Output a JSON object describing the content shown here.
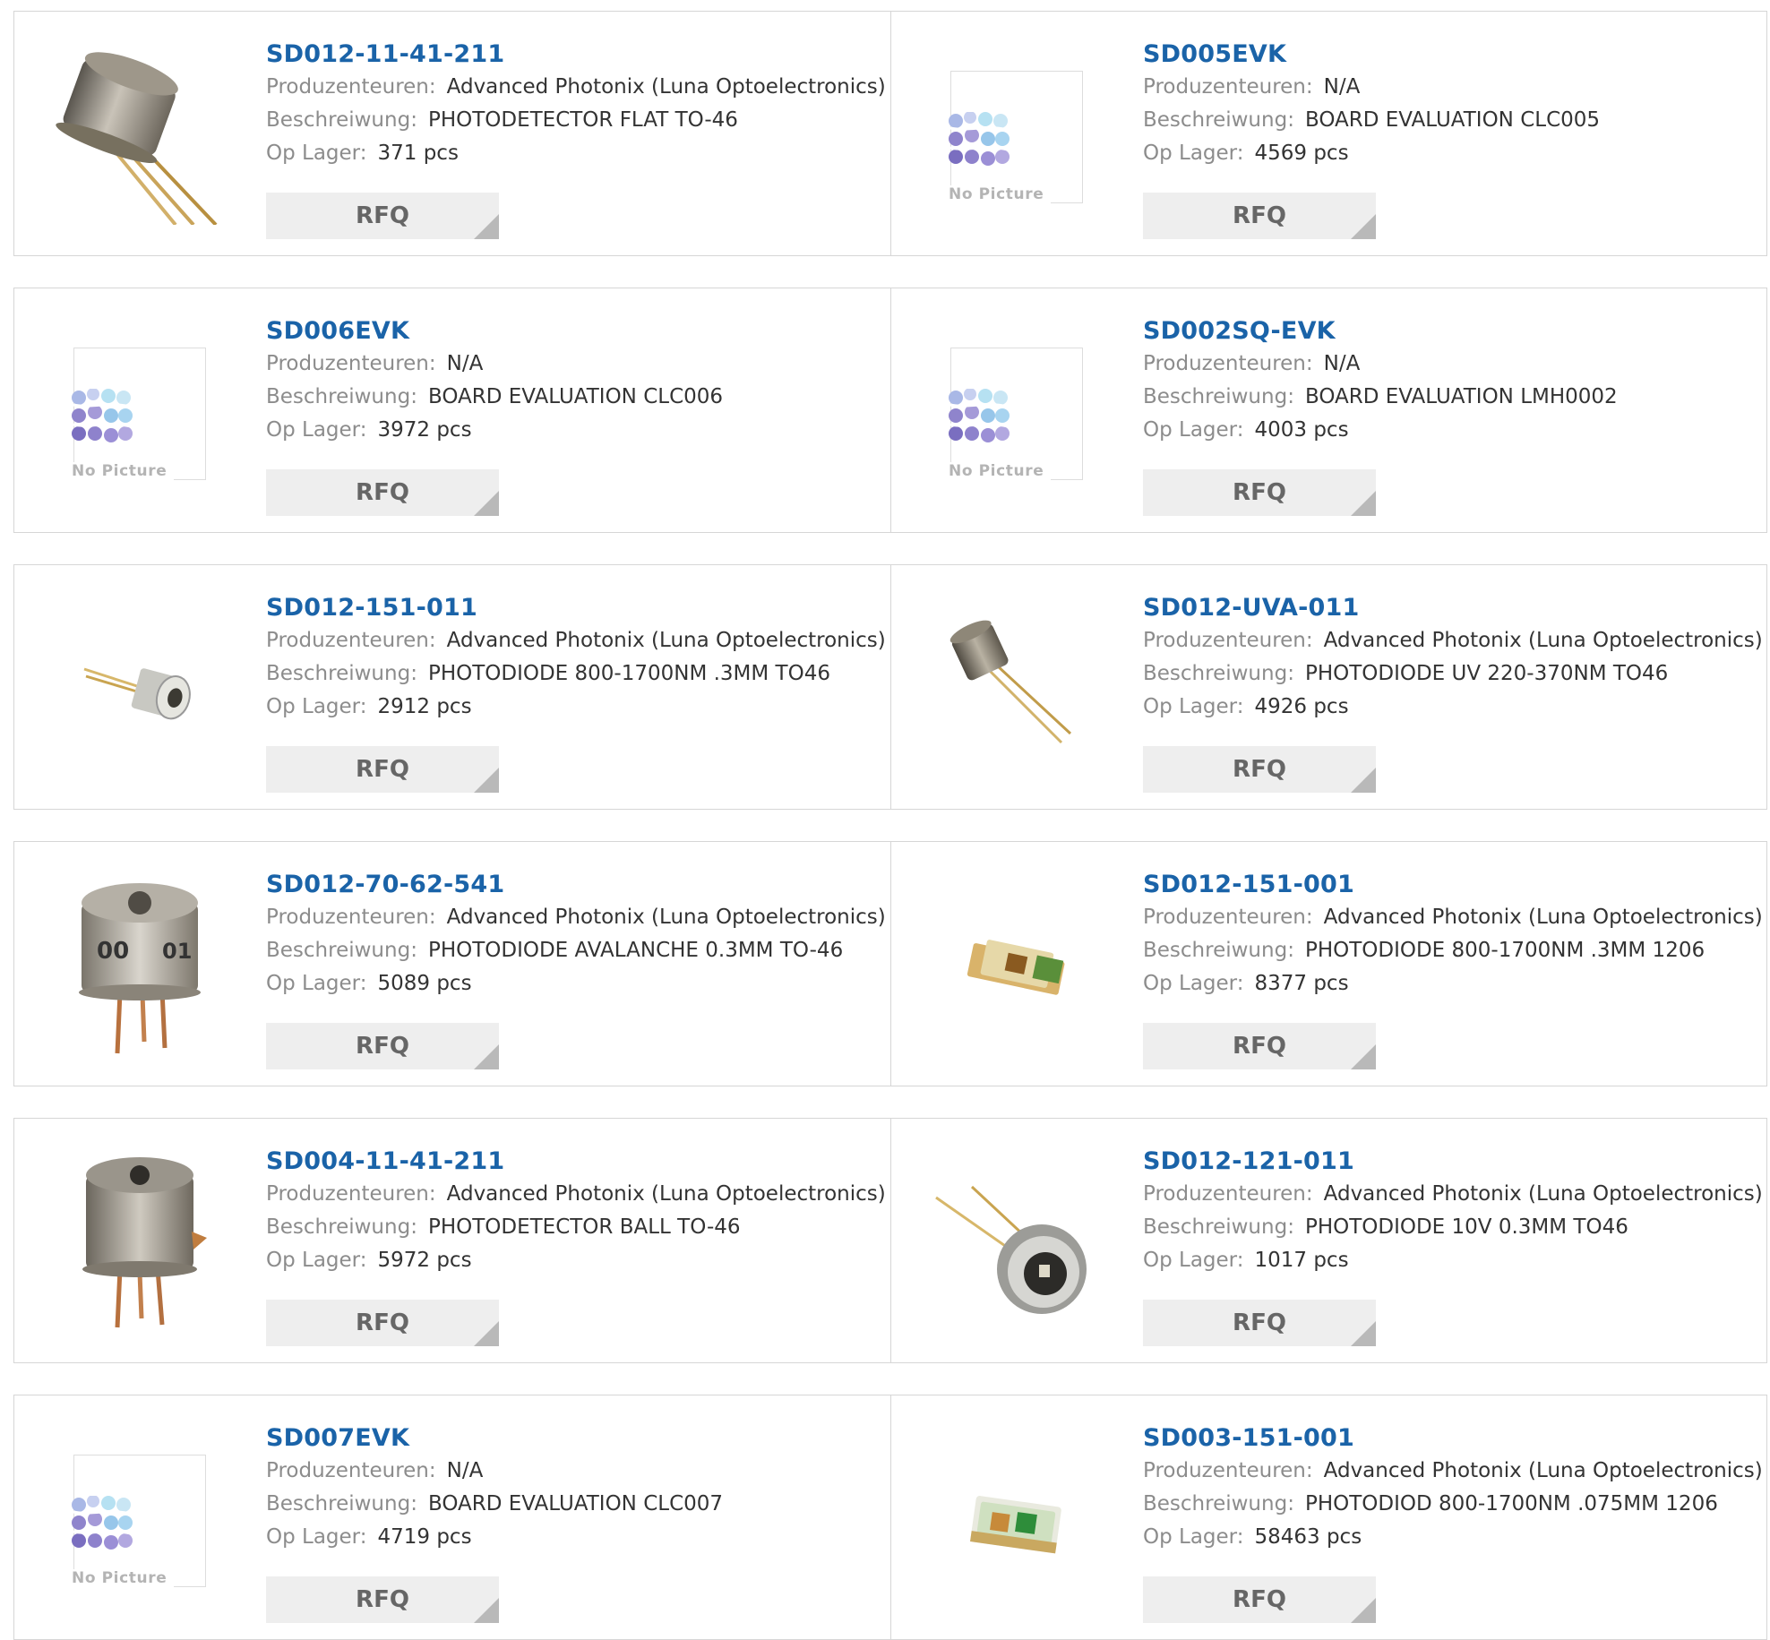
{
  "labels": {
    "manufacturer": "Produzenteuren:",
    "description": "Beschreiwung:",
    "stock": "Op Lager:",
    "rfq": "RFQ",
    "no_picture": "No Picture"
  },
  "products": [
    {
      "part": "SD012-11-41-211",
      "manufacturer": "Advanced Photonix (Luna Optoelectronics)",
      "description": "PHOTODETECTOR FLAT TO-46",
      "stock": "371 pcs",
      "image": "to46-flat-photodetector"
    },
    {
      "part": "SD005EVK",
      "manufacturer": "N/A",
      "description": "BOARD EVALUATION CLC005",
      "stock": "4569 pcs",
      "image": "no-picture"
    },
    {
      "part": "SD006EVK",
      "manufacturer": "N/A",
      "description": "BOARD EVALUATION CLC006",
      "stock": "3972 pcs",
      "image": "no-picture"
    },
    {
      "part": "SD002SQ-EVK",
      "manufacturer": "N/A",
      "description": "BOARD EVALUATION LMH0002",
      "stock": "4003 pcs",
      "image": "no-picture"
    },
    {
      "part": "SD012-151-011",
      "manufacturer": "Advanced Photonix (Luna Optoelectronics)",
      "description": "PHOTODIODE 800-1700NM .3MM TO46",
      "stock": "2912 pcs",
      "image": "to46-small-photodiode"
    },
    {
      "part": "SD012-UVA-011",
      "manufacturer": "Advanced Photonix (Luna Optoelectronics)",
      "description": "PHOTODIODE UV 220-370NM TO46",
      "stock": "4926 pcs",
      "image": "to46-uv-photodiode"
    },
    {
      "part": "SD012-70-62-541",
      "manufacturer": "Advanced Photonix (Luna Optoelectronics)",
      "description": "PHOTODIODE AVALANCHE 0.3MM TO-46",
      "stock": "5089 pcs",
      "image": "to46-avalanche-photodiode"
    },
    {
      "part": "SD012-151-001",
      "manufacturer": "Advanced Photonix (Luna Optoelectronics)",
      "description": "PHOTODIODE 800-1700NM .3MM 1206",
      "stock": "8377 pcs",
      "image": "smd-1206-photodiode"
    },
    {
      "part": "SD004-11-41-211",
      "manufacturer": "Advanced Photonix (Luna Optoelectronics)",
      "description": "PHOTODETECTOR BALL TO-46",
      "stock": "5972 pcs",
      "image": "to46-ball-photodetector"
    },
    {
      "part": "SD012-121-011",
      "manufacturer": "Advanced Photonix (Luna Optoelectronics)",
      "description": "PHOTODIODE 10V 0.3MM TO46",
      "stock": "1017 pcs",
      "image": "to46-10v-photodiode"
    },
    {
      "part": "SD007EVK",
      "manufacturer": "N/A",
      "description": "BOARD EVALUATION CLC007",
      "stock": "4719 pcs",
      "image": "no-picture"
    },
    {
      "part": "SD003-151-001",
      "manufacturer": "Advanced Photonix (Luna Optoelectronics)",
      "description": "PHOTODIOD 800-1700NM .075MM 1206",
      "stock": "58463 pcs",
      "image": "smd-1206-photodiode-green"
    }
  ],
  "colors": {
    "part_link": "#1a63a8",
    "label_gray": "#8c8c8c",
    "value_text": "#333333",
    "border": "#d6d6d6",
    "rfq_bg": "#eeeeee",
    "rfq_text": "#666666"
  }
}
